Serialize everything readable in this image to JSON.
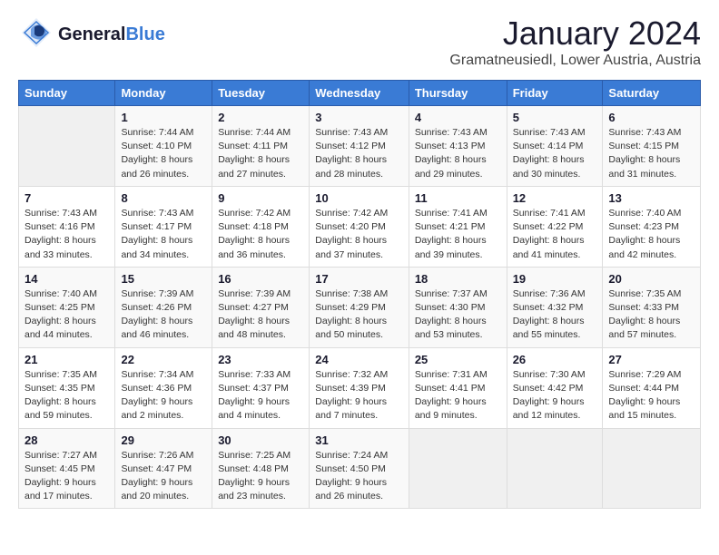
{
  "logo": {
    "general": "General",
    "blue": "Blue"
  },
  "header": {
    "month": "January 2024",
    "location": "Gramatneusiedl, Lower Austria, Austria"
  },
  "weekdays": [
    "Sunday",
    "Monday",
    "Tuesday",
    "Wednesday",
    "Thursday",
    "Friday",
    "Saturday"
  ],
  "weeks": [
    [
      {
        "day": "",
        "detail": ""
      },
      {
        "day": "1",
        "detail": "Sunrise: 7:44 AM\nSunset: 4:10 PM\nDaylight: 8 hours\nand 26 minutes."
      },
      {
        "day": "2",
        "detail": "Sunrise: 7:44 AM\nSunset: 4:11 PM\nDaylight: 8 hours\nand 27 minutes."
      },
      {
        "day": "3",
        "detail": "Sunrise: 7:43 AM\nSunset: 4:12 PM\nDaylight: 8 hours\nand 28 minutes."
      },
      {
        "day": "4",
        "detail": "Sunrise: 7:43 AM\nSunset: 4:13 PM\nDaylight: 8 hours\nand 29 minutes."
      },
      {
        "day": "5",
        "detail": "Sunrise: 7:43 AM\nSunset: 4:14 PM\nDaylight: 8 hours\nand 30 minutes."
      },
      {
        "day": "6",
        "detail": "Sunrise: 7:43 AM\nSunset: 4:15 PM\nDaylight: 8 hours\nand 31 minutes."
      }
    ],
    [
      {
        "day": "7",
        "detail": "Sunrise: 7:43 AM\nSunset: 4:16 PM\nDaylight: 8 hours\nand 33 minutes."
      },
      {
        "day": "8",
        "detail": "Sunrise: 7:43 AM\nSunset: 4:17 PM\nDaylight: 8 hours\nand 34 minutes."
      },
      {
        "day": "9",
        "detail": "Sunrise: 7:42 AM\nSunset: 4:18 PM\nDaylight: 8 hours\nand 36 minutes."
      },
      {
        "day": "10",
        "detail": "Sunrise: 7:42 AM\nSunset: 4:20 PM\nDaylight: 8 hours\nand 37 minutes."
      },
      {
        "day": "11",
        "detail": "Sunrise: 7:41 AM\nSunset: 4:21 PM\nDaylight: 8 hours\nand 39 minutes."
      },
      {
        "day": "12",
        "detail": "Sunrise: 7:41 AM\nSunset: 4:22 PM\nDaylight: 8 hours\nand 41 minutes."
      },
      {
        "day": "13",
        "detail": "Sunrise: 7:40 AM\nSunset: 4:23 PM\nDaylight: 8 hours\nand 42 minutes."
      }
    ],
    [
      {
        "day": "14",
        "detail": "Sunrise: 7:40 AM\nSunset: 4:25 PM\nDaylight: 8 hours\nand 44 minutes."
      },
      {
        "day": "15",
        "detail": "Sunrise: 7:39 AM\nSunset: 4:26 PM\nDaylight: 8 hours\nand 46 minutes."
      },
      {
        "day": "16",
        "detail": "Sunrise: 7:39 AM\nSunset: 4:27 PM\nDaylight: 8 hours\nand 48 minutes."
      },
      {
        "day": "17",
        "detail": "Sunrise: 7:38 AM\nSunset: 4:29 PM\nDaylight: 8 hours\nand 50 minutes."
      },
      {
        "day": "18",
        "detail": "Sunrise: 7:37 AM\nSunset: 4:30 PM\nDaylight: 8 hours\nand 53 minutes."
      },
      {
        "day": "19",
        "detail": "Sunrise: 7:36 AM\nSunset: 4:32 PM\nDaylight: 8 hours\nand 55 minutes."
      },
      {
        "day": "20",
        "detail": "Sunrise: 7:35 AM\nSunset: 4:33 PM\nDaylight: 8 hours\nand 57 minutes."
      }
    ],
    [
      {
        "day": "21",
        "detail": "Sunrise: 7:35 AM\nSunset: 4:35 PM\nDaylight: 8 hours\nand 59 minutes."
      },
      {
        "day": "22",
        "detail": "Sunrise: 7:34 AM\nSunset: 4:36 PM\nDaylight: 9 hours\nand 2 minutes."
      },
      {
        "day": "23",
        "detail": "Sunrise: 7:33 AM\nSunset: 4:37 PM\nDaylight: 9 hours\nand 4 minutes."
      },
      {
        "day": "24",
        "detail": "Sunrise: 7:32 AM\nSunset: 4:39 PM\nDaylight: 9 hours\nand 7 minutes."
      },
      {
        "day": "25",
        "detail": "Sunrise: 7:31 AM\nSunset: 4:41 PM\nDaylight: 9 hours\nand 9 minutes."
      },
      {
        "day": "26",
        "detail": "Sunrise: 7:30 AM\nSunset: 4:42 PM\nDaylight: 9 hours\nand 12 minutes."
      },
      {
        "day": "27",
        "detail": "Sunrise: 7:29 AM\nSunset: 4:44 PM\nDaylight: 9 hours\nand 15 minutes."
      }
    ],
    [
      {
        "day": "28",
        "detail": "Sunrise: 7:27 AM\nSunset: 4:45 PM\nDaylight: 9 hours\nand 17 minutes."
      },
      {
        "day": "29",
        "detail": "Sunrise: 7:26 AM\nSunset: 4:47 PM\nDaylight: 9 hours\nand 20 minutes."
      },
      {
        "day": "30",
        "detail": "Sunrise: 7:25 AM\nSunset: 4:48 PM\nDaylight: 9 hours\nand 23 minutes."
      },
      {
        "day": "31",
        "detail": "Sunrise: 7:24 AM\nSunset: 4:50 PM\nDaylight: 9 hours\nand 26 minutes."
      },
      {
        "day": "",
        "detail": ""
      },
      {
        "day": "",
        "detail": ""
      },
      {
        "day": "",
        "detail": ""
      }
    ]
  ]
}
